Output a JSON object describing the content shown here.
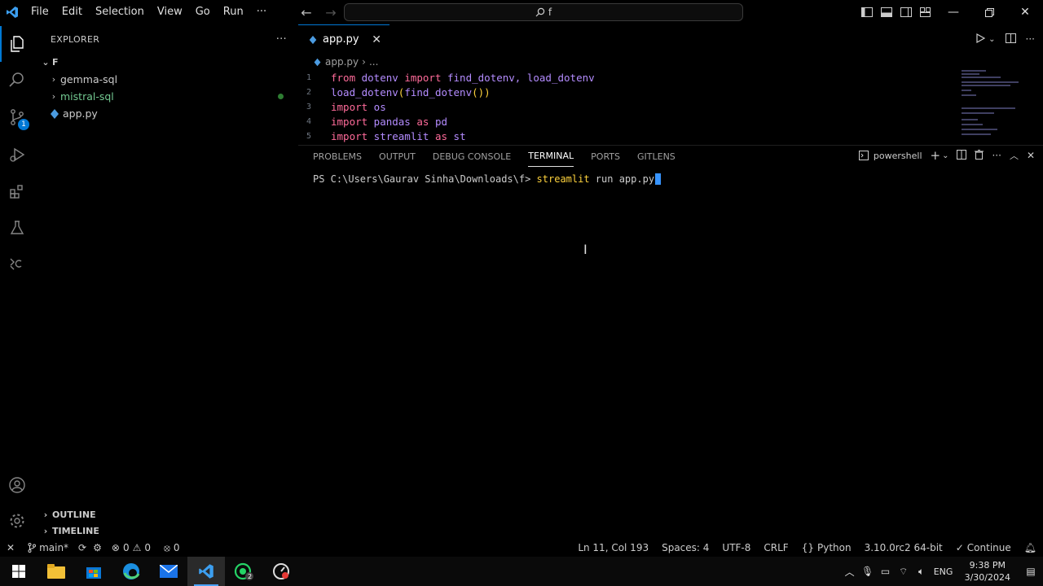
{
  "menu": [
    "File",
    "Edit",
    "Selection",
    "View",
    "Go",
    "Run",
    "···"
  ],
  "command_center": {
    "text": "f"
  },
  "sidebar": {
    "title": "EXPLORER",
    "more": "···",
    "root": "F",
    "items": [
      {
        "label": "gemma-sql",
        "type": "folder",
        "color": "normal"
      },
      {
        "label": "mistral-sql",
        "type": "folder",
        "color": "green"
      },
      {
        "label": "app.py",
        "type": "file",
        "color": "normal"
      }
    ],
    "outline": "OUTLINE",
    "timeline": "TIMELINE"
  },
  "activity_badge": "1",
  "editor": {
    "tab": "app.py",
    "breadcrumb": {
      "file": "app.py",
      "rest": "..."
    },
    "lines": [
      {
        "n": "1",
        "t": [
          [
            "kw",
            "from"
          ],
          [
            "mod",
            " dotenv "
          ],
          [
            "kw",
            "import"
          ],
          [
            "fn",
            " find_dotenv"
          ],
          [
            "mod",
            ", "
          ],
          [
            "fn",
            "load_dotenv"
          ]
        ]
      },
      {
        "n": "2",
        "t": [
          [
            "fn",
            "load_dotenv"
          ],
          [
            "punc",
            "("
          ],
          [
            "fn",
            "find_dotenv"
          ],
          [
            "punc",
            "())"
          ]
        ]
      },
      {
        "n": "3",
        "t": [
          [
            "kw",
            "import"
          ],
          [
            "mod",
            " os"
          ]
        ]
      },
      {
        "n": "4",
        "t": [
          [
            "kw",
            "import"
          ],
          [
            "mod",
            " pandas "
          ],
          [
            "kw",
            "as"
          ],
          [
            "mod",
            " pd"
          ]
        ]
      },
      {
        "n": "5",
        "t": [
          [
            "kw",
            "import"
          ],
          [
            "mod",
            " streamlit "
          ],
          [
            "kw",
            "as"
          ],
          [
            "mod",
            " st"
          ]
        ]
      }
    ]
  },
  "panel": {
    "tabs": [
      "PROBLEMS",
      "OUTPUT",
      "DEBUG CONSOLE",
      "TERMINAL",
      "PORTS",
      "GITLENS"
    ],
    "active_tab": "TERMINAL",
    "shell": "powershell",
    "terminal": {
      "prompt": "PS C:\\Users\\Gaurav Sinha\\Downloads\\f> ",
      "cmd": "streamlit",
      "args": " run app.py"
    }
  },
  "status": {
    "branch": "main*",
    "errors": "0",
    "warnings": "0",
    "ports": "0",
    "position": "Ln 11, Col 193",
    "spaces": "Spaces: 4",
    "encoding": "UTF-8",
    "eol": "CRLF",
    "language": "Python",
    "interpreter": "3.10.0rc2 64-bit",
    "continue": "Continue"
  },
  "taskbar": {
    "lang": "ENG",
    "time": "9:38 PM",
    "date": "3/30/2024"
  },
  "colors": {
    "accent": "#0078d4",
    "keyword": "#ff6b9a",
    "module": "#b48cff",
    "paren": "#ffd33d",
    "git_green": "#73c991"
  }
}
